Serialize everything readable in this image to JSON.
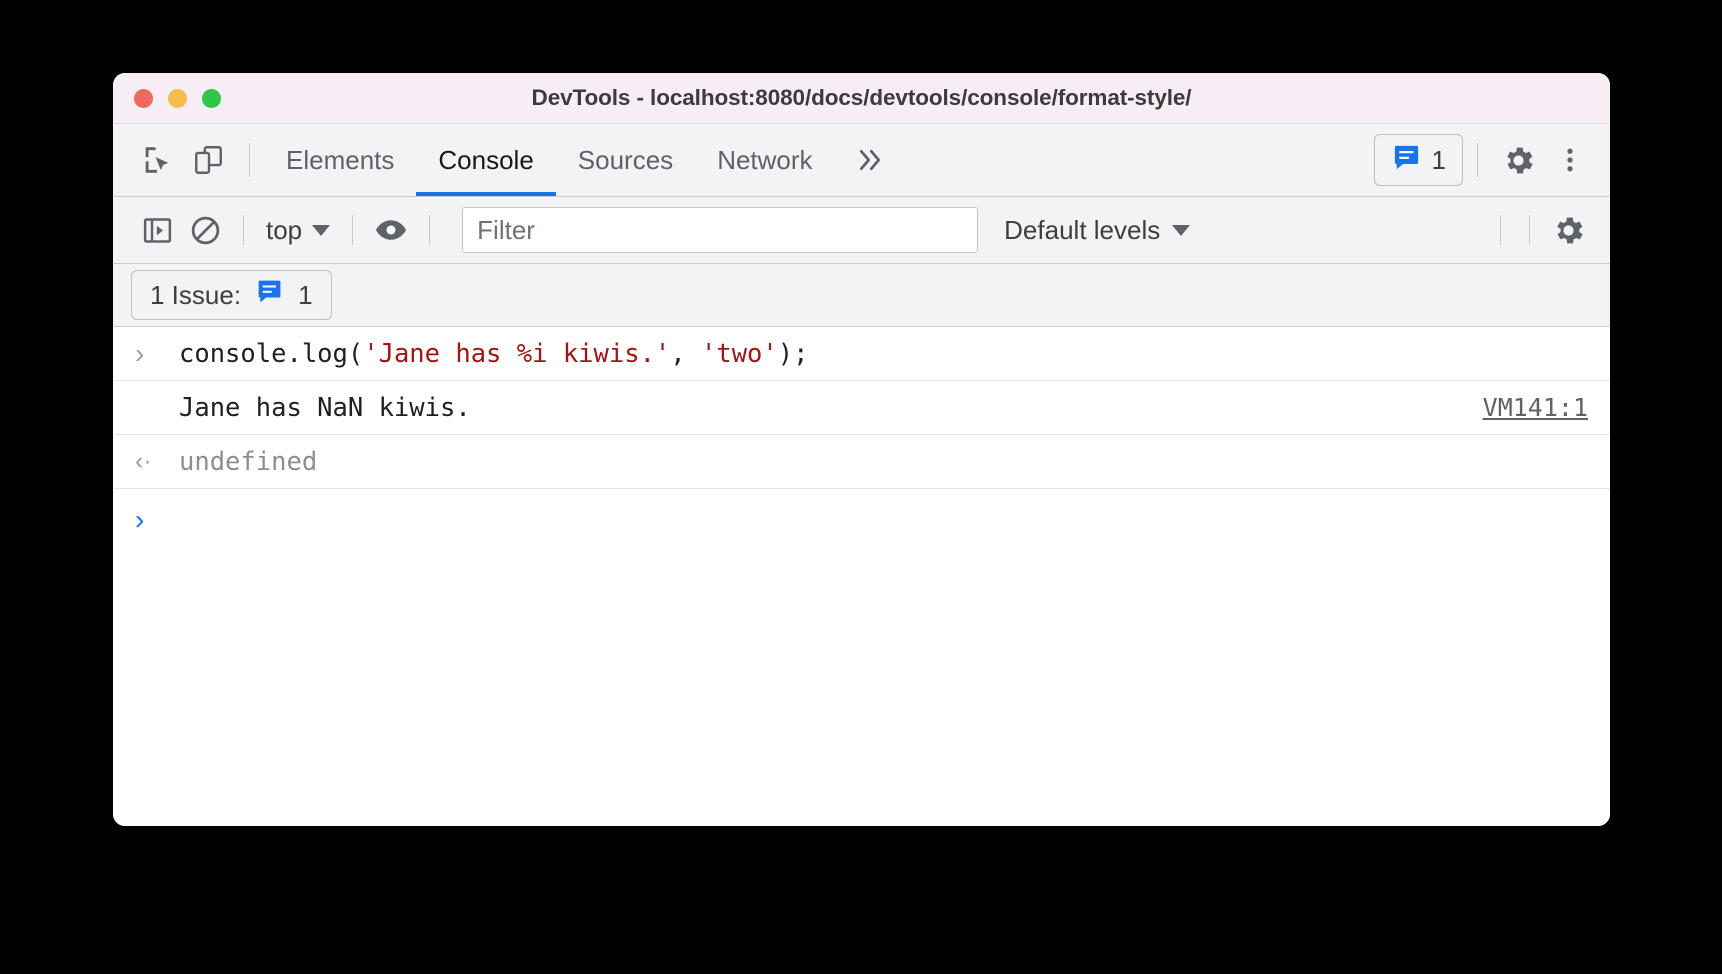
{
  "window": {
    "title": "DevTools - localhost:8080/docs/devtools/console/format-style/",
    "traffic_lights": [
      "close",
      "minimize",
      "maximize"
    ]
  },
  "tabbar": {
    "inspect_icon": "inspect-element-icon",
    "device_icon": "device-toolbar-icon",
    "tabs": [
      {
        "label": "Elements",
        "active": false
      },
      {
        "label": "Console",
        "active": true
      },
      {
        "label": "Sources",
        "active": false
      },
      {
        "label": "Network",
        "active": false
      }
    ],
    "more_tabs_label": "»",
    "issues_badge_count": "1",
    "issues_badge_icon": "issues-bubble-icon",
    "settings_icon": "gear-icon",
    "menu_icon": "kebab-menu-icon"
  },
  "console_toolbar": {
    "sidebar_icon": "console-sidebar-icon",
    "clear_icon": "clear-console-icon",
    "context_value": "top",
    "eye_icon": "live-expression-icon",
    "filter_placeholder": "Filter",
    "filter_value": "",
    "levels_value": "Default levels",
    "settings_icon": "console-settings-gear-icon"
  },
  "issues_bar": {
    "label": "1 Issue:",
    "icon": "issues-bubble-icon",
    "count": "1"
  },
  "console_rows": [
    {
      "type": "input",
      "gutter": ">",
      "segments": [
        {
          "text": "console.log(",
          "kind": "plain"
        },
        {
          "text": "'Jane has %i kiwis.'",
          "kind": "string"
        },
        {
          "text": ", ",
          "kind": "plain"
        },
        {
          "text": "'two'",
          "kind": "string"
        },
        {
          "text": ");",
          "kind": "plain"
        }
      ],
      "full_text": "console.log('Jane has %i kiwis.', 'two');"
    },
    {
      "type": "output",
      "gutter": "",
      "text": "Jane has NaN kiwis.",
      "source_link": "VM141:1"
    },
    {
      "type": "result",
      "gutter": "‹·",
      "text": "undefined"
    },
    {
      "type": "empty_prompt",
      "gutter": ">",
      "text": ""
    }
  ],
  "colors": {
    "accent": "#1a73e8",
    "string_red": "#a31515",
    "titlebar_bg": "#f7eef5",
    "toolbar_bg": "#f1f3f4"
  }
}
